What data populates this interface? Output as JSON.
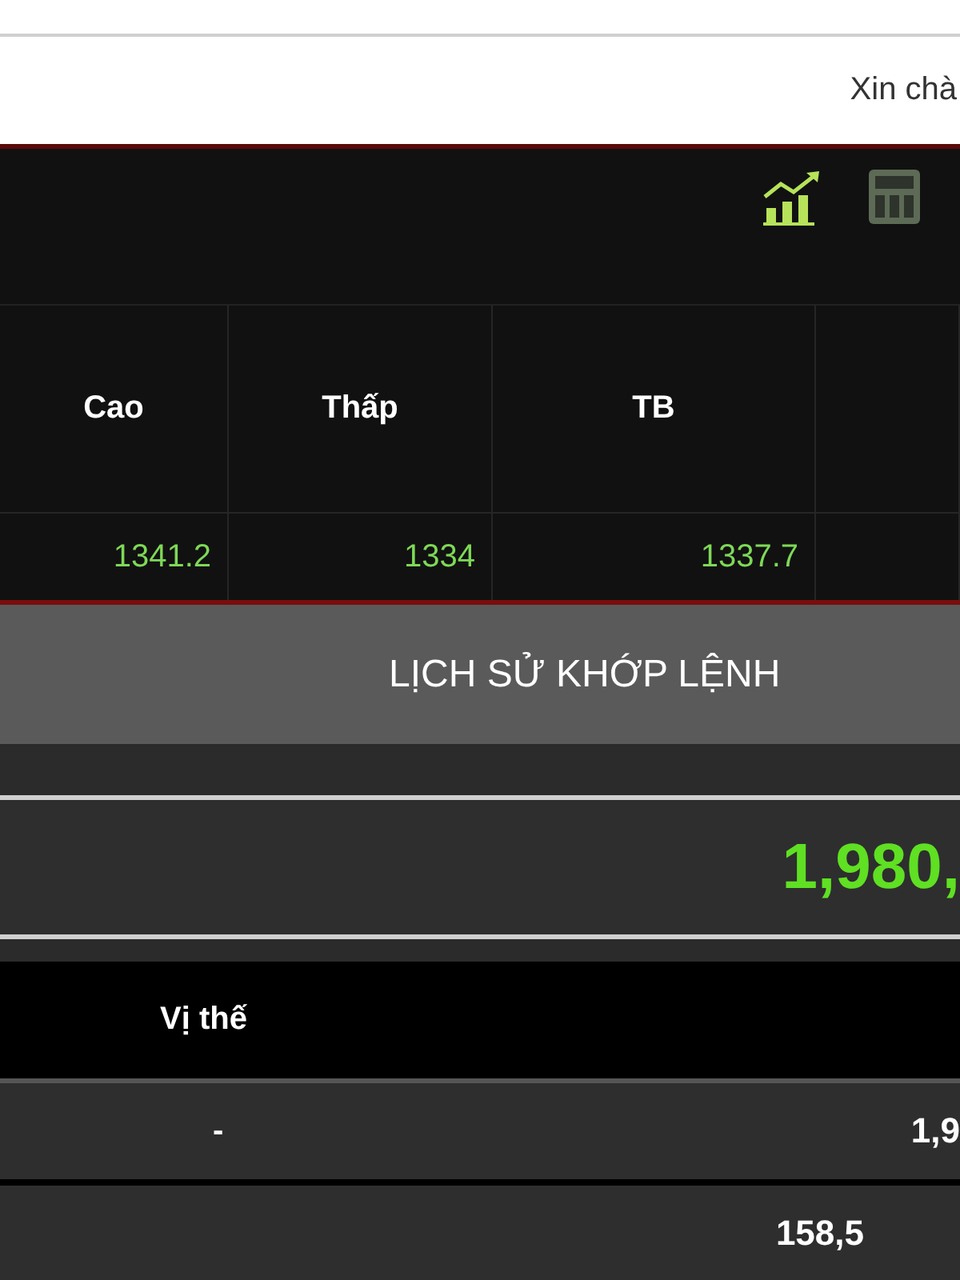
{
  "header": {
    "greeting": "Xin chà"
  },
  "toolbar": {
    "icons": [
      {
        "kind": "chart",
        "selected": true
      },
      {
        "kind": "calculator",
        "selected": false
      }
    ]
  },
  "price_table": {
    "columns": [
      "Cao",
      "Thấp",
      "TB"
    ],
    "rows": [
      [
        "1341.2",
        "1334",
        "1337.7"
      ]
    ]
  },
  "history": {
    "title": "LỊCH SỬ KHỚP LỆNH",
    "total": "1,980,"
  },
  "position_table": {
    "columns": [
      "Vị thế"
    ],
    "rows": [
      {
        "cells": [
          "-",
          "1,9"
        ]
      },
      {
        "cells": [
          "",
          "158,5"
        ]
      }
    ]
  }
}
